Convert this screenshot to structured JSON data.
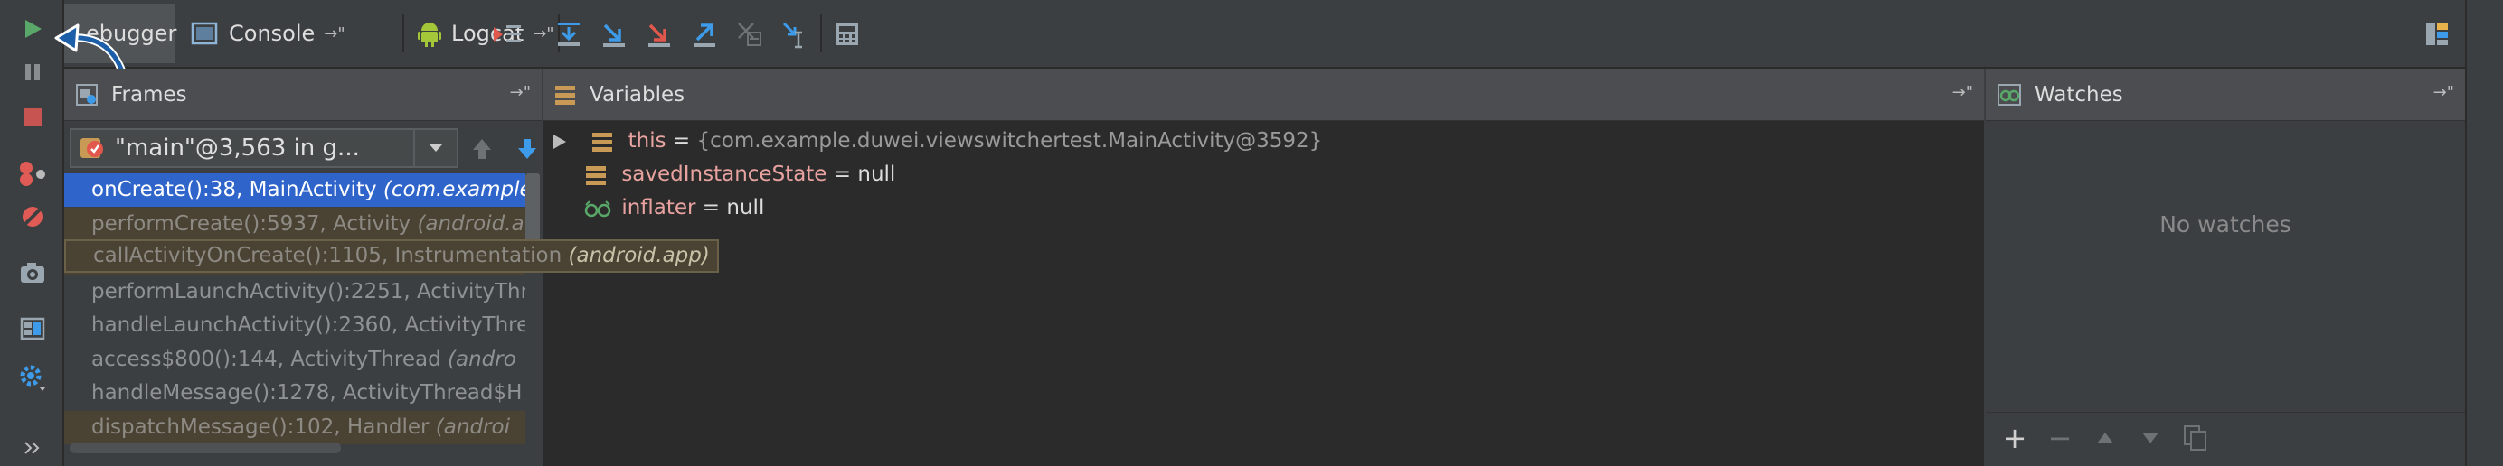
{
  "tabs": {
    "debugger": "ebugger",
    "console": "Console",
    "logcat": "Logcat"
  },
  "icons": {
    "left_toolbar": [
      "resume-program-icon",
      "pause-program-icon",
      "stop-icon",
      "view-breakpoints-icon",
      "mute-breakpoints-icon",
      "get-thread-dump-icon",
      "restore-layout-icon",
      "settings-icon",
      "expand-more-icon"
    ],
    "debug_toolbar": [
      "show-execution-point-icon",
      "step-over-icon",
      "step-into-icon",
      "force-step-into-icon",
      "step-out-icon",
      "drop-frame-icon",
      "run-to-cursor-icon",
      "evaluate-expression-icon"
    ]
  },
  "frames": {
    "title": "Frames",
    "thread": "\"main\"@3,563 in g...",
    "rows": [
      {
        "method": "onCreate():38, MainActivity ",
        "pkg": "(com.example",
        "style": "sel"
      },
      {
        "method": "performCreate():5937, Activity ",
        "pkg": "(android.a",
        "style": "lib"
      },
      {
        "method": "callActivityOnCreate():1105, Instrumentation ",
        "pkg": "(android.app)",
        "style": "lib"
      },
      {
        "method": "performLaunchActivity():2251, ActivityThr",
        "pkg": "",
        "style": "norm"
      },
      {
        "method": "handleLaunchActivity():2360, ActivityThre",
        "pkg": "",
        "style": "norm"
      },
      {
        "method": "access$800():144, ActivityThread ",
        "pkg": "(andro",
        "style": "norm"
      },
      {
        "method": "handleMessage():1278, ActivityThread$H",
        "pkg": "",
        "style": "norm"
      },
      {
        "method": "dispatchMessage():102, Handler ",
        "pkg": "(androi",
        "style": "lib"
      }
    ]
  },
  "variables": {
    "title": "Variables",
    "rows": [
      {
        "name": "this",
        "eq": " = ",
        "value": "{com.example.duwei.viewswitchertest.MainActivity@3592}",
        "grey": true
      },
      {
        "name": "savedInstanceState",
        "eq": " = ",
        "value": "null",
        "grey": false
      },
      {
        "name": "inflater",
        "eq": " = ",
        "value": "null",
        "grey": false
      }
    ]
  },
  "watches": {
    "title": "Watches",
    "empty_text": "No watches"
  },
  "colors": {
    "accent_selection": "#2f65ca",
    "resume_green": "#59a869",
    "stop_red": "#c75450",
    "step_blue": "#3d9be9",
    "step_red": "#e2574c",
    "var_name": "#e8a3a0"
  }
}
